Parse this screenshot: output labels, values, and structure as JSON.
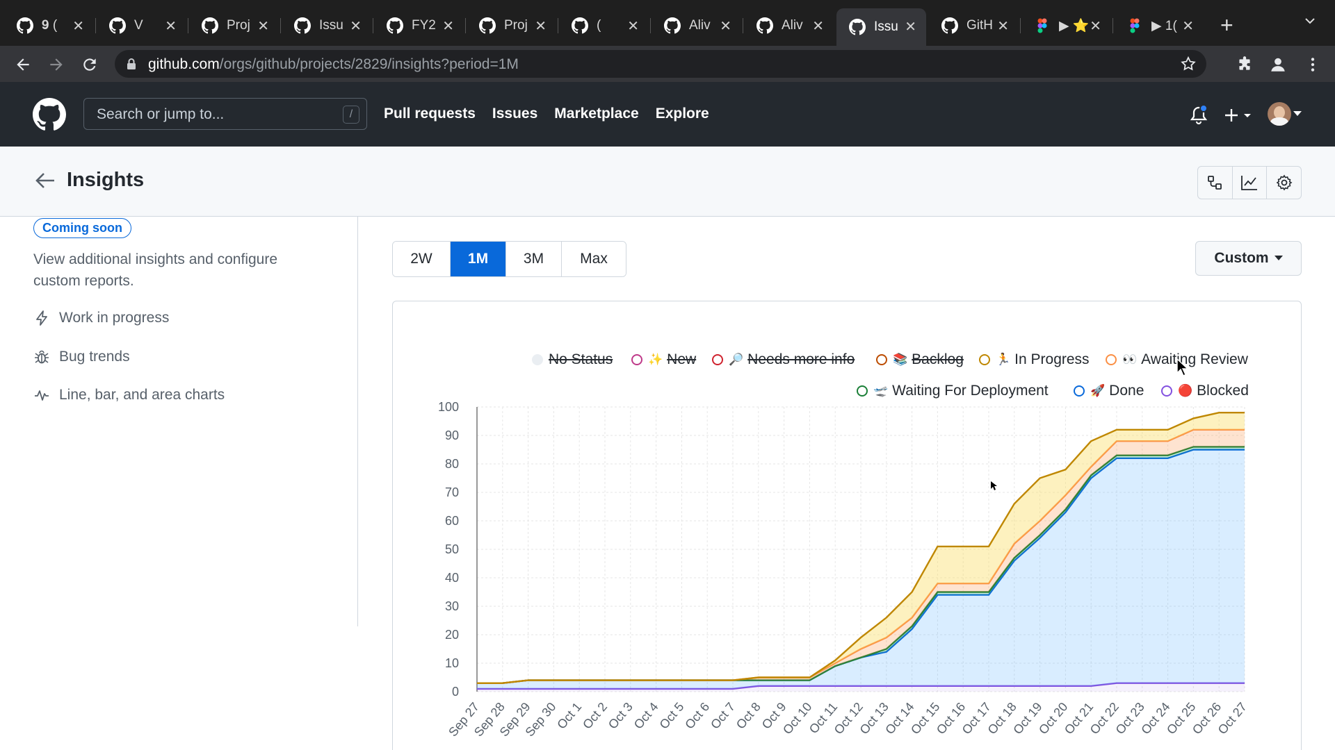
{
  "browser": {
    "tabs": [
      {
        "title": "𝟗 (",
        "active": false
      },
      {
        "title": "V",
        "active": false
      },
      {
        "title": "Proj",
        "active": false
      },
      {
        "title": "Issu",
        "active": false
      },
      {
        "title": "FY2",
        "active": false
      },
      {
        "title": "Proj",
        "active": false
      },
      {
        "title": "(",
        "active": false
      },
      {
        "title": "Aliv",
        "active": false
      },
      {
        "title": "Aliv",
        "active": false
      },
      {
        "title": "Issu",
        "active": true
      },
      {
        "title": "GitH",
        "active": false
      },
      {
        "title": "▶ ⭐",
        "active": false
      },
      {
        "title": "▶ 1(",
        "active": false
      }
    ],
    "url_host": "github.com",
    "url_path": "/orgs/github/projects/2829/insights?period=1M"
  },
  "header": {
    "search_placeholder": "Search or jump to...",
    "search_shortcut": "/",
    "nav": [
      "Pull requests",
      "Issues",
      "Marketplace",
      "Explore"
    ]
  },
  "page": {
    "title": "Insights"
  },
  "sidebar": {
    "badge": "Coming soon",
    "description": "View additional insights and configure custom reports.",
    "items": [
      "Work in progress",
      "Bug trends",
      "Line, bar, and area charts"
    ]
  },
  "period": {
    "options": [
      "2W",
      "1M",
      "3M",
      "Max"
    ],
    "selected": "1M"
  },
  "custom_label": "Custom",
  "legend": [
    {
      "label": "No Status",
      "color": "#d0d7de",
      "hidden": true,
      "emoji": ""
    },
    {
      "label": "New",
      "color": "#bf3989",
      "hidden": true,
      "emoji": "✨"
    },
    {
      "label": "Needs more info",
      "color": "#cf222e",
      "hidden": true,
      "emoji": "🔎"
    },
    {
      "label": "Backlog",
      "color": "#bc4c00",
      "hidden": true,
      "emoji": "📚"
    },
    {
      "label": "In Progress",
      "color": "#bf8700",
      "hidden": false,
      "emoji": "🏃"
    },
    {
      "label": "Awaiting Review",
      "color": "#fb8f44",
      "hidden": false,
      "emoji": "👀"
    },
    {
      "label": "Waiting For Deployment",
      "color": "#1a7f37",
      "hidden": false,
      "emoji": "🛫"
    },
    {
      "label": "Done",
      "color": "#0969da",
      "hidden": false,
      "emoji": "🚀"
    },
    {
      "label": "Blocked",
      "color": "#8250df",
      "hidden": false,
      "emoji": "🔴"
    }
  ],
  "chart_data": {
    "type": "area",
    "stacked": true,
    "ylim": [
      0,
      100
    ],
    "yticks": [
      0,
      10,
      20,
      30,
      40,
      50,
      60,
      70,
      80,
      90,
      100
    ],
    "categories": [
      "Sep 27",
      "Sep 28",
      "Sep 29",
      "Sep 30",
      "Oct 1",
      "Oct 2",
      "Oct 3",
      "Oct 4",
      "Oct 5",
      "Oct 6",
      "Oct 7",
      "Oct 8",
      "Oct 9",
      "Oct 10",
      "Oct 11",
      "Oct 12",
      "Oct 13",
      "Oct 14",
      "Oct 15",
      "Oct 16",
      "Oct 17",
      "Oct 18",
      "Oct 19",
      "Oct 20",
      "Oct 21",
      "Oct 22",
      "Oct 23",
      "Oct 24",
      "Oct 25",
      "Oct 26",
      "Oct 27"
    ],
    "series": [
      {
        "name": "Blocked",
        "color": "#8250df",
        "values": [
          1,
          1,
          1,
          1,
          1,
          1,
          1,
          1,
          1,
          1,
          1,
          2,
          2,
          2,
          2,
          2,
          2,
          2,
          2,
          2,
          2,
          2,
          2,
          2,
          2,
          3,
          3,
          3,
          3,
          3,
          3
        ]
      },
      {
        "name": "Done",
        "color": "#0969da",
        "values": [
          2,
          2,
          3,
          3,
          3,
          3,
          3,
          3,
          3,
          3,
          3,
          2,
          2,
          2,
          7,
          10,
          12,
          20,
          32,
          32,
          32,
          44,
          52,
          61,
          73,
          79,
          79,
          79,
          82,
          82,
          82
        ]
      },
      {
        "name": "Waiting For Deployment",
        "color": "#1a7f37",
        "values": [
          0,
          0,
          0,
          0,
          0,
          0,
          0,
          0,
          0,
          0,
          0,
          0,
          0,
          0,
          0,
          0,
          1,
          1,
          1,
          1,
          1,
          1,
          1,
          1,
          1,
          1,
          1,
          1,
          1,
          1,
          1
        ]
      },
      {
        "name": "Awaiting Review",
        "color": "#fb8f44",
        "values": [
          0,
          0,
          0,
          0,
          0,
          0,
          0,
          0,
          0,
          0,
          0,
          1,
          1,
          1,
          1,
          3,
          4,
          3,
          3,
          3,
          3,
          5,
          5,
          5,
          3,
          5,
          5,
          5,
          6,
          6,
          6
        ]
      },
      {
        "name": "In Progress",
        "color": "#bf8700",
        "values": [
          0,
          0,
          0,
          0,
          0,
          0,
          0,
          0,
          0,
          0,
          0,
          0,
          0,
          0,
          1,
          4,
          7,
          9,
          13,
          13,
          13,
          14,
          15,
          9,
          9,
          4,
          4,
          4,
          4,
          6,
          6
        ]
      }
    ]
  }
}
